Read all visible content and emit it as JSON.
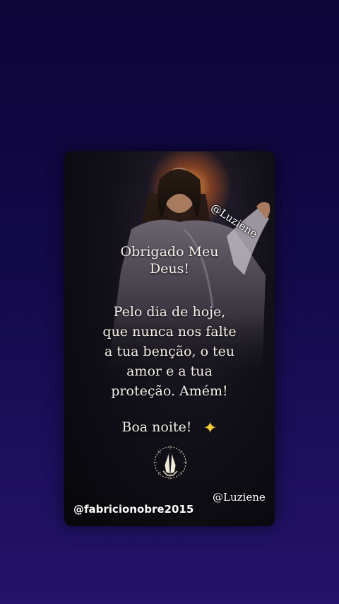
{
  "card": {
    "title_line1": "Obrigado Meu",
    "title_line2": "Deus!",
    "body_lines": [
      "Pelo dia de hoje,",
      "que nunca nos falte",
      "a tua benção, o teu",
      "amor e a tua",
      "proteção. Amém!"
    ],
    "closing": "Boa noite!",
    "closing_icon": "sparkling-star-icon",
    "emblem_icon": "praying-hands-icon",
    "watermark_top": "@Luziene",
    "watermark_bottom": "@Luziene"
  },
  "overlay": {
    "handle": "@fabricionobre2015"
  },
  "colors": {
    "background_top": "#0d0438",
    "background_bottom": "#24136a",
    "text": "#f4f1ea",
    "star": "#f6c93a"
  }
}
